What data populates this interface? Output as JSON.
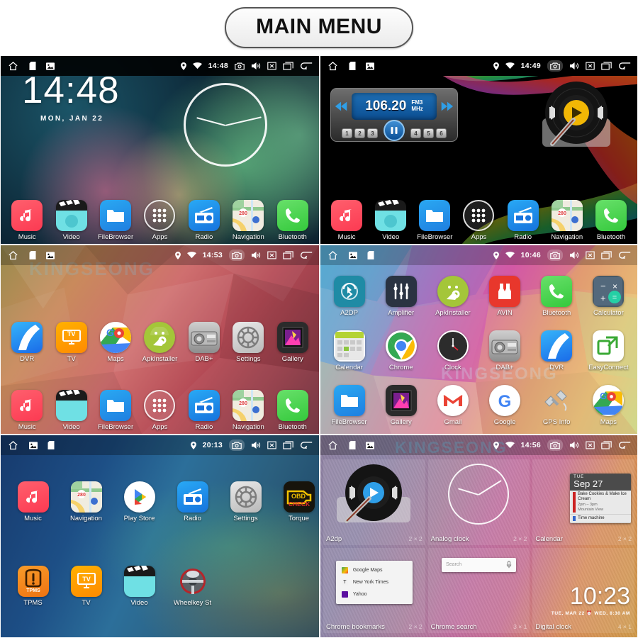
{
  "header": {
    "title": "MAIN MENU"
  },
  "watermark": "KINGSEONG",
  "statusbar_icons": [
    "home-icon",
    "sd-card-icon",
    "image-icon",
    "location-icon",
    "wifi-icon",
    "camera-icon",
    "volume-icon",
    "close-icon",
    "recents-icon",
    "back-icon"
  ],
  "panels": [
    {
      "id": "home-clock",
      "status": {
        "time": "14:48",
        "camera_highlighted": false
      },
      "clock": {
        "time": "14:48",
        "date": "MON, JAN 22"
      },
      "dock": [
        {
          "label": "Music",
          "icon": "music-icon"
        },
        {
          "label": "Video",
          "icon": "video-icon"
        },
        {
          "label": "FileBrowser",
          "icon": "folder-icon"
        },
        {
          "label": "Apps",
          "icon": "app-drawer-icon"
        },
        {
          "label": "Radio",
          "icon": "radio-icon"
        },
        {
          "label": "Navigation",
          "icon": "map-icon"
        },
        {
          "label": "Bluetooth",
          "icon": "phone-icon"
        }
      ]
    },
    {
      "id": "home-radio",
      "status": {
        "time": "14:49",
        "camera_highlighted": true
      },
      "radio": {
        "frequency": "106.20",
        "band": "FM3",
        "unit": "MHz",
        "presets": [
          "1",
          "2",
          "3",
          "4",
          "5",
          "6"
        ],
        "transport": [
          "prev",
          "pause",
          "next"
        ]
      },
      "vinyl": {
        "play": "play-icon",
        "prev": "prev-icon",
        "next": "next-icon"
      },
      "dock": [
        {
          "label": "Music",
          "icon": "music-icon"
        },
        {
          "label": "Video",
          "icon": "video-icon"
        },
        {
          "label": "FileBrowser",
          "icon": "folder-icon"
        },
        {
          "label": "Apps",
          "icon": "app-drawer-icon"
        },
        {
          "label": "Radio",
          "icon": "radio-icon"
        },
        {
          "label": "Navigation",
          "icon": "map-icon"
        },
        {
          "label": "Bluetooth",
          "icon": "phone-icon"
        }
      ]
    },
    {
      "id": "home-apps",
      "status": {
        "time": "14:53",
        "camera_highlighted": true
      },
      "row_top": [
        {
          "label": "DVR",
          "icon": "dvr-icon"
        },
        {
          "label": "TV",
          "icon": "tv-icon"
        },
        {
          "label": "Maps",
          "icon": "maps-icon"
        },
        {
          "label": "ApkInstaller",
          "icon": "android-icon"
        },
        {
          "label": "DAB+",
          "icon": "dab-radio-icon"
        },
        {
          "label": "Settings",
          "icon": "gear-icon"
        },
        {
          "label": "Gallery",
          "icon": "gallery-icon"
        }
      ],
      "dock": [
        {
          "label": "Music",
          "icon": "music-icon"
        },
        {
          "label": "Video",
          "icon": "video-icon"
        },
        {
          "label": "FileBrowser",
          "icon": "folder-icon"
        },
        {
          "label": "Apps",
          "icon": "app-drawer-icon"
        },
        {
          "label": "Radio",
          "icon": "radio-icon"
        },
        {
          "label": "Navigation",
          "icon": "map-icon"
        },
        {
          "label": "Bluetooth",
          "icon": "phone-icon"
        }
      ]
    },
    {
      "id": "app-drawer",
      "status": {
        "time": "10:46",
        "camera_highlighted": true
      },
      "rows": [
        [
          {
            "label": "A2DP",
            "icon": "a2dp-icon"
          },
          {
            "label": "Amplifier",
            "icon": "equalizer-icon"
          },
          {
            "label": "ApkInstaller",
            "icon": "android-icon"
          },
          {
            "label": "AVIN",
            "icon": "avin-icon"
          },
          {
            "label": "Bluetooth",
            "icon": "phone-icon"
          },
          {
            "label": "Calculator",
            "icon": "calculator-icon"
          }
        ],
        [
          {
            "label": "Calendar",
            "icon": "calendar-icon"
          },
          {
            "label": "Chrome",
            "icon": "chrome-icon"
          },
          {
            "label": "Clock",
            "icon": "clock-icon"
          },
          {
            "label": "DAB+",
            "icon": "dab-radio-icon"
          },
          {
            "label": "DVR",
            "icon": "dvr-icon"
          },
          {
            "label": "EasyConnect",
            "icon": "easyconnect-icon"
          }
        ],
        [
          {
            "label": "FileBrowser",
            "icon": "folder-icon"
          },
          {
            "label": "Gallery",
            "icon": "gallery-icon"
          },
          {
            "label": "Gmail",
            "icon": "gmail-icon"
          },
          {
            "label": "Google",
            "icon": "google-icon"
          },
          {
            "label": "GPS Info",
            "icon": "satellite-icon"
          },
          {
            "label": "Maps",
            "icon": "maps-icon"
          }
        ]
      ]
    },
    {
      "id": "home-apps-2",
      "status": {
        "time": "20:13",
        "camera_highlighted": true
      },
      "rows": [
        [
          {
            "label": "Music",
            "icon": "music-icon"
          },
          {
            "label": "Navigation",
            "icon": "map-icon"
          },
          {
            "label": "Play Store",
            "icon": "play-store-icon"
          },
          {
            "label": "Radio",
            "icon": "radio-icon"
          },
          {
            "label": "Settings",
            "icon": "gear-icon"
          },
          {
            "label": "Torque",
            "icon": "obd-check-icon"
          }
        ],
        [
          {
            "label": "TPMS",
            "icon": "tpms-icon"
          },
          {
            "label": "TV",
            "icon": "tv-icon"
          },
          {
            "label": "Video",
            "icon": "video-icon"
          },
          {
            "label": "Wheelkey St",
            "icon": "steering-wheel-icon"
          }
        ]
      ]
    },
    {
      "id": "widgets",
      "status": {
        "time": "14:56",
        "camera_highlighted": true
      },
      "widgets": [
        {
          "name": "A2dp",
          "size": "2 × 2",
          "type": "vinyl-player"
        },
        {
          "name": "Analog clock",
          "size": "2 × 2",
          "type": "analog-clock"
        },
        {
          "name": "Calendar",
          "size": "2 × 2",
          "type": "calendar",
          "calendar": {
            "weekday": "TUE",
            "date": "Sep 27",
            "events": [
              {
                "title": "Bake Cookies & Make Ice Cream",
                "time": "2pm – 3pm",
                "place": "Mountain View"
              },
              {
                "title": "Time machine",
                "time": "",
                "place": ""
              }
            ]
          }
        },
        {
          "name": "Chrome bookmarks",
          "size": "2 × 2",
          "type": "bookmark-list",
          "bookmarks": [
            "Google Maps",
            "New York Times",
            "Yahoo"
          ]
        },
        {
          "name": "Chrome search",
          "size": "3 × 1",
          "type": "search-box",
          "placeholder": "Search"
        },
        {
          "name": "Digital clock",
          "size": "4 × 1",
          "type": "digital-clock",
          "clock": {
            "time": "10:23",
            "date": "TUE, MAR 22",
            "alarm": "WED, 8:30 AM"
          }
        }
      ]
    }
  ]
}
